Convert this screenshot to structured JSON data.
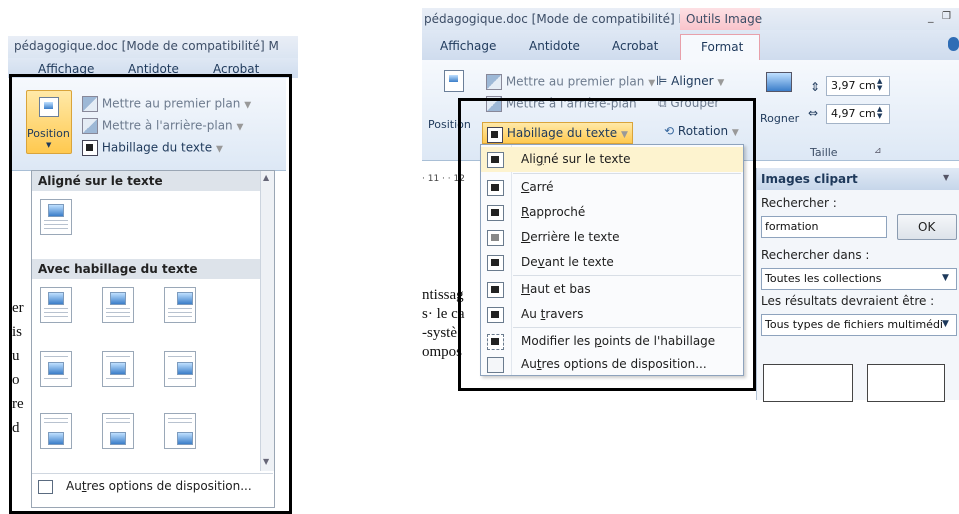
{
  "left": {
    "title": "pédagogique.doc [Mode de compatibilité] M",
    "tabs": [
      "Affichage",
      "Antidote",
      "Acrobat"
    ],
    "position_label": "Position",
    "bring_front": "Mettre au premier plan",
    "send_back": "Mettre à l'arrière-plan",
    "wrap_text": "Habillage du texte",
    "section_inline": "Aligné sur le texte",
    "section_wrap": "Avec habillage du texte",
    "more_options_pre": "Au",
    "more_options_u": "t",
    "more_options_post": "res options de disposition...",
    "doc_letters": [
      "er",
      "is",
      "u",
      "o",
      "re",
      "d"
    ]
  },
  "right": {
    "title": "pédagogique.doc [Mode de compatibilité] M",
    "context_tab": "Outils Image",
    "tabs": [
      "Affichage",
      "Antidote",
      "Acrobat"
    ],
    "format_tab": "Format",
    "bring_front": "Mettre au premier plan",
    "send_back": "Mettre à l'arrière-plan",
    "align": "Aligner",
    "group": "Grouper",
    "rotation": "Rotation",
    "position_label": "Position",
    "wrap_text": "Habillage du texte",
    "crop": "Rogner",
    "height": "3,97 cm",
    "width": "4,97 cm",
    "size_group": "Taille",
    "ruler": "· 11 · · 12",
    "menu": [
      {
        "pre": "Ali",
        "u": "g",
        "post": "né sur le texte"
      },
      {
        "pre": "",
        "u": "C",
        "post": "arré"
      },
      {
        "pre": "",
        "u": "R",
        "post": "approché"
      },
      {
        "pre": "",
        "u": "D",
        "post": "errière le texte"
      },
      {
        "pre": "De",
        "u": "v",
        "post": "ant le texte"
      },
      {
        "pre": "",
        "u": "H",
        "post": "aut et bas"
      },
      {
        "pre": "Au ",
        "u": "t",
        "post": "ravers"
      },
      {
        "pre": "Modifier les ",
        "u": "p",
        "post": "oints de l'habillage"
      },
      {
        "pre": "Au",
        "u": "t",
        "post": "res options de disposition..."
      }
    ],
    "doc_lines": [
      "ntissag",
      "s· le ca",
      "-systè",
      "ompos"
    ],
    "clipart": {
      "title": "Images clipart",
      "search_label": "Rechercher :",
      "search_value": "formation",
      "ok": "OK",
      "search_in_label": "Rechercher dans :",
      "search_in_value": "Toutes les collections",
      "results_label": "Les résultats devraient être :",
      "results_value": "Tous types de fichiers multimédi"
    }
  }
}
